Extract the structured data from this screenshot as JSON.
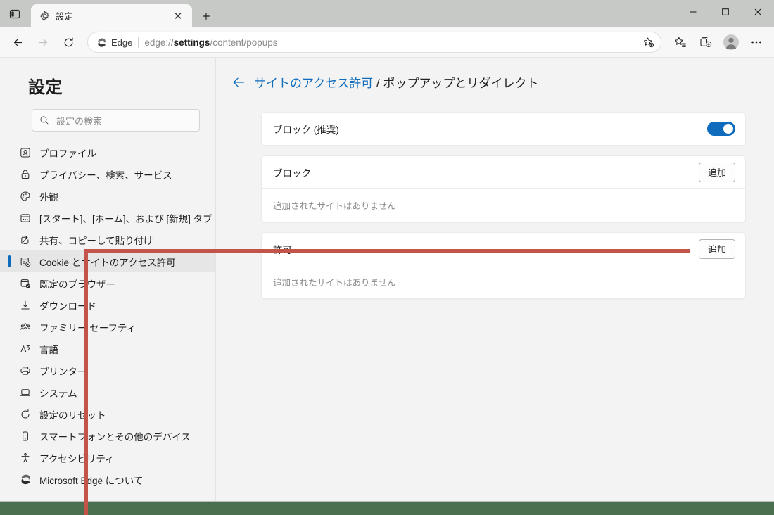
{
  "window": {
    "tab": {
      "title": "設定",
      "icon": "gear-icon",
      "close_label": "✕"
    },
    "new_tab_label": "＋",
    "tab_actions_icon": "split-screen-icon",
    "controls": {
      "minimize": "—",
      "maximize": "▢",
      "close": "✕"
    }
  },
  "toolbar": {
    "back": "←",
    "forward": "→",
    "refresh": "⟳",
    "edge_badge_label": "Edge",
    "url_prefix": "edge://",
    "url_bold": "settings",
    "url_suffix": "/content/popups",
    "favorite_add_icon": "star-add-icon",
    "favorites_icon": "favorites-list-icon",
    "collections_icon": "collections-icon",
    "profile_icon": "profile-avatar-icon",
    "more_icon": "ellipsis-icon"
  },
  "sidebar": {
    "title": "設定",
    "search": {
      "placeholder": "設定の検索",
      "icon": "search-icon"
    },
    "items": [
      {
        "label": "プロファイル",
        "icon": "profile-icon",
        "selected": false
      },
      {
        "label": "プライバシー、検索、サービス",
        "icon": "lock-icon",
        "selected": false
      },
      {
        "label": "外観",
        "icon": "palette-icon",
        "selected": false
      },
      {
        "label": "[スタート]、[ホーム]、および [新規] タブ",
        "icon": "browser-window-icon",
        "selected": false
      },
      {
        "label": "共有、コピーして貼り付け",
        "icon": "share-icon",
        "selected": false
      },
      {
        "label": "Cookie とサイトのアクセス許可",
        "icon": "cookie-gear-icon",
        "selected": true
      },
      {
        "label": "既定のブラウザー",
        "icon": "browser-check-icon",
        "selected": false
      },
      {
        "label": "ダウンロード",
        "icon": "download-icon",
        "selected": false
      },
      {
        "label": "ファミリー セーフティ",
        "icon": "people-icon",
        "selected": false
      },
      {
        "label": "言語",
        "icon": "translate-icon",
        "selected": false
      },
      {
        "label": "プリンター",
        "icon": "printer-icon",
        "selected": false
      },
      {
        "label": "システム",
        "icon": "laptop-icon",
        "selected": false
      },
      {
        "label": "設定のリセット",
        "icon": "reset-icon",
        "selected": false
      },
      {
        "label": "スマートフォンとその他のデバイス",
        "icon": "phone-icon",
        "selected": false
      },
      {
        "label": "アクセシビリティ",
        "icon": "accessibility-icon",
        "selected": false
      },
      {
        "label": "Microsoft Edge について",
        "icon": "edge-logo-icon",
        "selected": false
      }
    ]
  },
  "content": {
    "breadcrumb": {
      "back_icon": "arrow-left-icon",
      "parent": "サイトのアクセス許可",
      "separator": " / ",
      "current": "ポップアップとリダイレクト"
    },
    "cards": [
      {
        "title": "ブロック (推奨)",
        "control": "toggle",
        "toggle_on": true,
        "empty_text": null,
        "add_label": null
      },
      {
        "title": "ブロック",
        "control": "add-button",
        "add_label": "追加",
        "empty_text": "追加されたサイトはありません"
      },
      {
        "title": "許可",
        "control": "add-button",
        "add_label": "追加",
        "empty_text": "追加されたサイトはありません"
      }
    ]
  },
  "colors": {
    "accent": "#0f6cbd",
    "annotation": "#c4534a",
    "desktop": "#4b7050",
    "page_bg": "#f3f3f3"
  }
}
